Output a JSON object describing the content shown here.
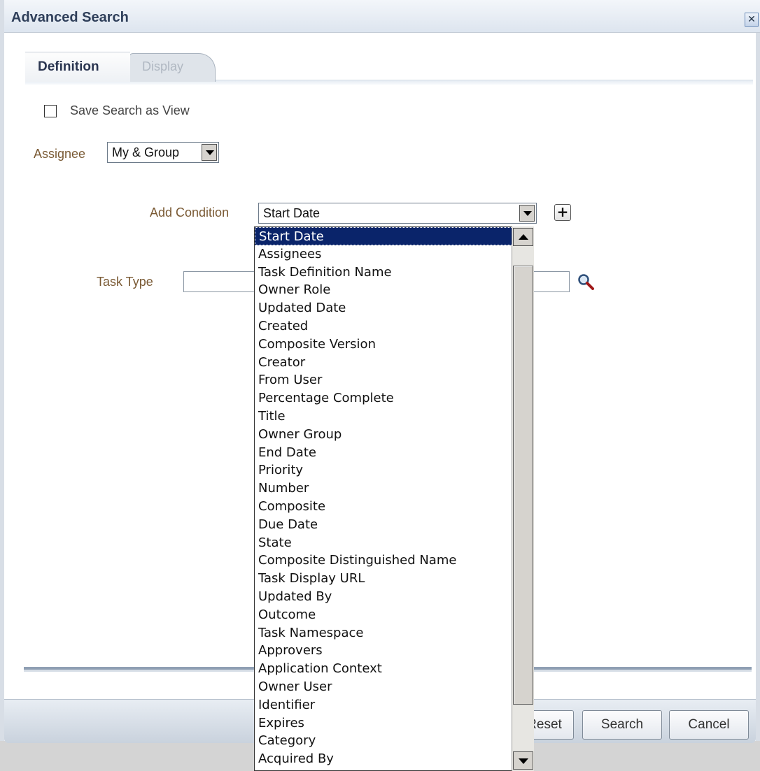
{
  "window": {
    "title": "Advanced Search",
    "close_icon": "close-icon"
  },
  "tabs": [
    {
      "label": "Definition",
      "active": true
    },
    {
      "label": "Display",
      "active": false
    }
  ],
  "save_view": {
    "label": "Save Search as View",
    "checked": false
  },
  "assignee": {
    "label": "Assignee",
    "value": "My & Group"
  },
  "add_condition": {
    "label": "Add Condition",
    "value": "Start Date"
  },
  "task_type": {
    "label": "Task Type",
    "value": ""
  },
  "dropdown": {
    "selected": "Start Date",
    "options": [
      "Start Date",
      "Assignees",
      "Task Definition Name",
      "Owner Role",
      "Updated Date",
      "Created",
      "Composite Version",
      "Creator",
      "From User",
      "Percentage Complete",
      "Title",
      "Owner Group",
      "End Date",
      "Priority",
      "Number",
      "Composite",
      "Due Date",
      "State",
      "Composite Distinguished Name",
      "Task Display URL",
      "Updated By",
      "Outcome",
      "Task Namespace",
      "Approvers",
      "Application Context",
      "Owner User",
      "Identifier",
      "Expires",
      "Category",
      "Acquired By"
    ]
  },
  "footer": {
    "reset_label": "Reset",
    "search_label": "Search",
    "cancel_label": "Cancel"
  },
  "colors": {
    "selection": "#0a246a",
    "label_brown": "#7a5a34",
    "title_text": "#2f3f5a"
  }
}
